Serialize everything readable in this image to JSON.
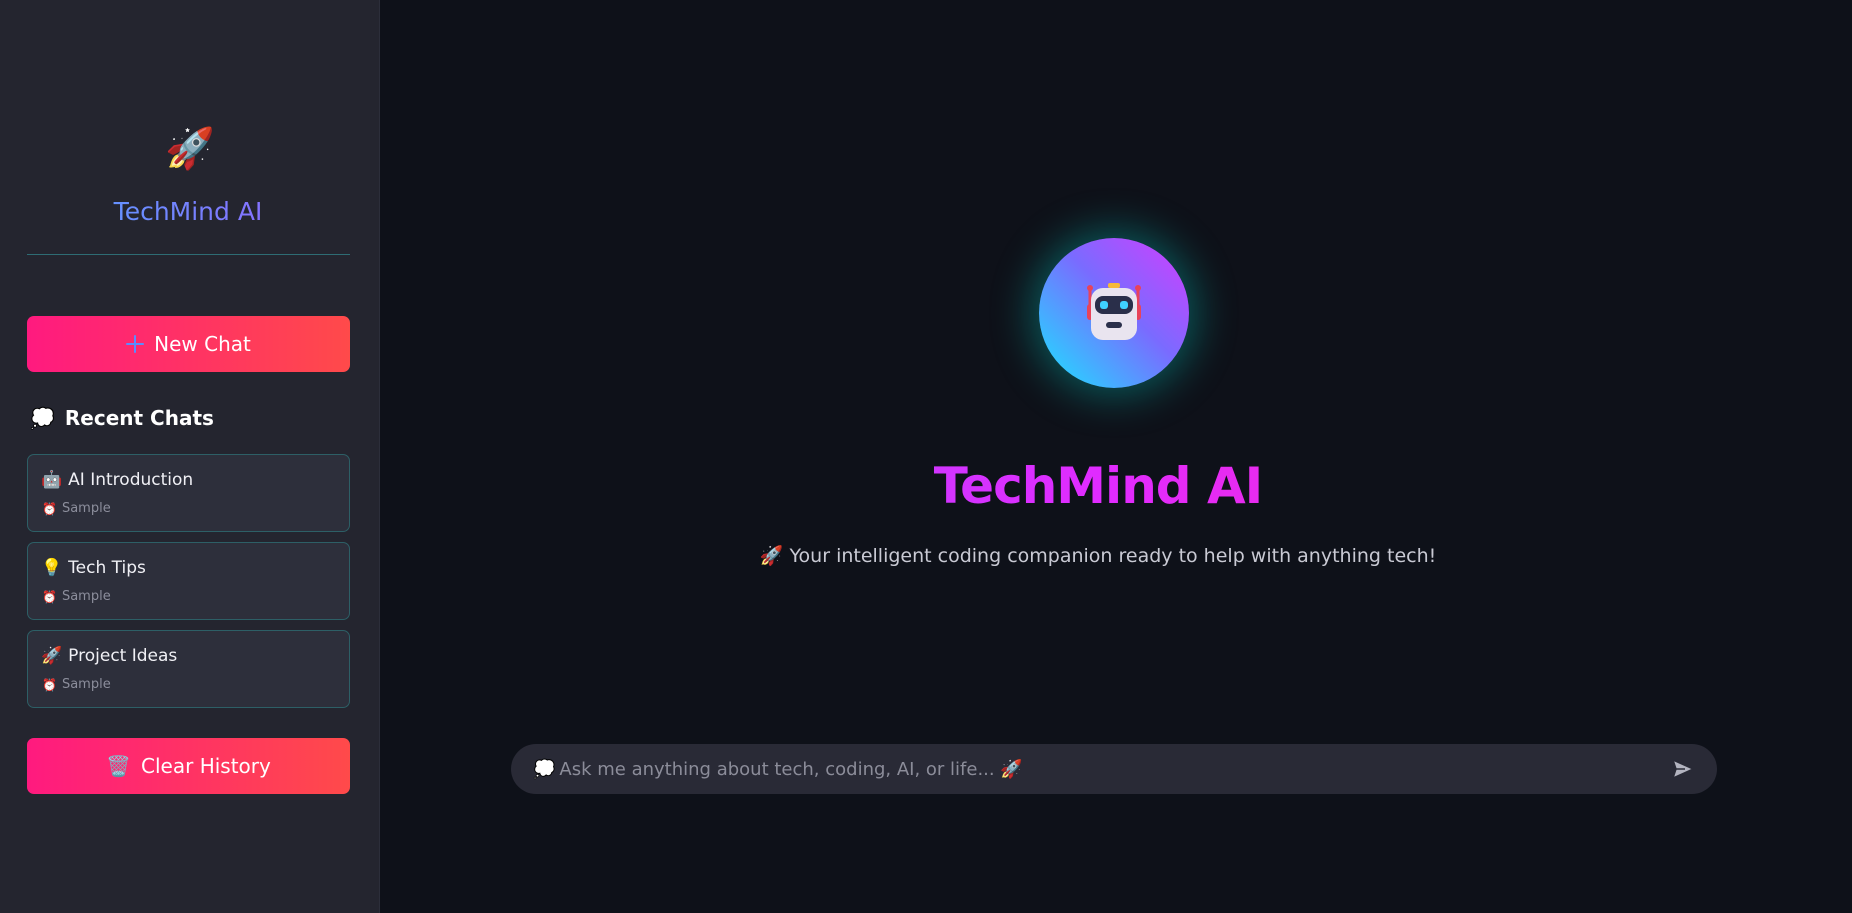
{
  "sidebar": {
    "logo_emoji": "🚀",
    "brand_title": "TechMind AI",
    "new_chat_label": "New Chat",
    "recent_header_emoji": "💭",
    "recent_header": "Recent Chats",
    "chats": [
      {
        "emoji": "🤖",
        "title": "AI Introduction",
        "meta_emoji": "⏰",
        "meta": "Sample"
      },
      {
        "emoji": "💡",
        "title": "Tech Tips",
        "meta_emoji": "⏰",
        "meta": "Sample"
      },
      {
        "emoji": "🚀",
        "title": "Project Ideas",
        "meta_emoji": "⏰",
        "meta": "Sample"
      }
    ],
    "clear_history_emoji": "🗑️",
    "clear_history_label": "Clear History"
  },
  "main": {
    "avatar_icon": "robot-icon",
    "title": "TechMind AI",
    "subtitle": "🚀 Your intelligent coding companion ready to help with anything tech!",
    "input": {
      "leading_emoji": "💭",
      "placeholder": "Ask me anything about tech, coding, AI, or life... 🚀",
      "value": ""
    },
    "send_icon": "send-icon"
  },
  "colors": {
    "sidebar_bg": "#24252f",
    "main_bg": "#0e1119",
    "button_gradient_start": "#ff1a7f",
    "button_gradient_end": "#ff4a4a",
    "accent_teal": "#2d5f66"
  }
}
